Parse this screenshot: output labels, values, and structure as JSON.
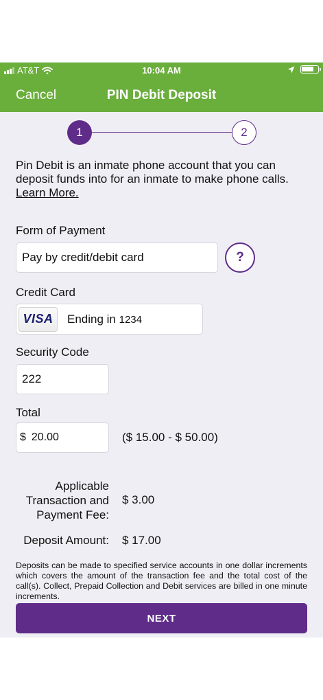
{
  "status_bar": {
    "carrier": "AT&T",
    "time": "10:04 AM"
  },
  "nav": {
    "cancel_label": "Cancel",
    "title": "PIN Debit Deposit"
  },
  "stepper": {
    "steps": [
      "1",
      "2"
    ],
    "current_step": 1
  },
  "intro": {
    "text": "Pin Debit is an inmate phone account that you can deposit funds into for an inmate to make phone calls.",
    "learn_more": "Learn More."
  },
  "form": {
    "payment_label": "Form of Payment",
    "payment_value": "Pay by credit/debit card",
    "help_label": "?",
    "card_label": "Credit Card",
    "card_brand": "VISA",
    "card_text": "Ending in",
    "card_digits": "1234",
    "security_label": "Security Code",
    "security_value": "222",
    "total_label": "Total",
    "currency": "$",
    "total_value": "20.00",
    "range": "($ 15.00 - $ 50.00)"
  },
  "summary": {
    "fee_label_1": "Applicable",
    "fee_label_2": "Transaction and",
    "fee_label_3": "Payment Fee:",
    "fee_value": "$ 3.00",
    "deposit_label": "Deposit Amount:",
    "deposit_value": "$ 17.00"
  },
  "disclaimer": "Deposits can be made to specified service accounts in one dollar increments which covers the amount of the transaction fee and the total cost of the call(s). Collect, Prepaid Collection and Debit services are billed in one minute increments.",
  "next_label": "NEXT",
  "colors": {
    "header_green": "#6aae3c",
    "accent_purple": "#5f2c8a",
    "background": "#efeef4"
  }
}
